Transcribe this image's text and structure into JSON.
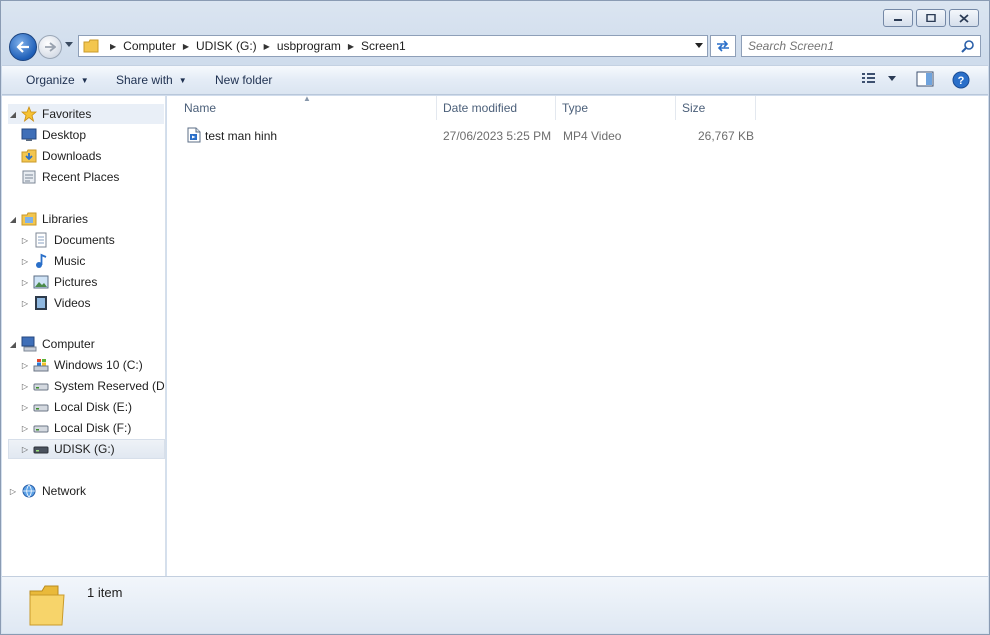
{
  "window": {
    "caption_buttons": [
      {
        "name": "minimize-button"
      },
      {
        "name": "maximize-button"
      },
      {
        "name": "close-button"
      }
    ]
  },
  "address_bar": {
    "breadcrumb": [
      "Computer",
      "UDISK (G:)",
      "usbprogram",
      "Screen1"
    ]
  },
  "search": {
    "placeholder": "Search Screen1"
  },
  "toolbar": {
    "organize_label": "Organize",
    "share_label": "Share with",
    "new_folder_label": "New folder"
  },
  "nav": {
    "favorites": {
      "label": "Favorites",
      "items": [
        "Desktop",
        "Downloads",
        "Recent Places"
      ]
    },
    "libraries": {
      "label": "Libraries",
      "items": [
        "Documents",
        "Music",
        "Pictures",
        "Videos"
      ]
    },
    "computer": {
      "label": "Computer",
      "items": [
        "Windows 10 (C:)",
        "System Reserved (D:",
        "Local Disk (E:)",
        "Local Disk (F:)",
        "UDISK (G:)"
      ]
    },
    "network": {
      "label": "Network"
    }
  },
  "columns": {
    "name": "Name",
    "date": "Date modified",
    "type": "Type",
    "size": "Size"
  },
  "files": [
    {
      "name": "test man hinh",
      "date": "27/06/2023 5:25 PM",
      "type": "MP4 Video",
      "size": "26,767 KB"
    }
  ],
  "details": {
    "count": "1 item"
  },
  "colors": {
    "accent": "#1f5fb8",
    "folder": "#f3c64f",
    "header_text": "#4c607a"
  }
}
